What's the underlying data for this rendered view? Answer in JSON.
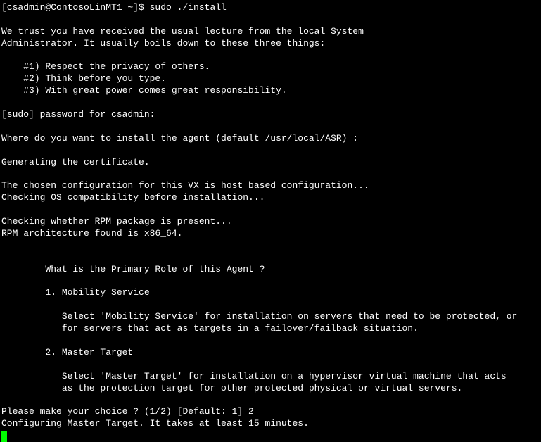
{
  "terminal": {
    "prompt_line": "[csadmin@ContosoLinMT1 ~]$ sudo ./install",
    "blank": "",
    "lecture_1": "We trust you have received the usual lecture from the local System",
    "lecture_2": "Administrator. It usually boils down to these three things:",
    "rule_1": "    #1) Respect the privacy of others.",
    "rule_2": "    #2) Think before you type.",
    "rule_3": "    #3) With great power comes great responsibility.",
    "password_prompt": "[sudo] password for csadmin:",
    "install_location": "Where do you want to install the agent (default /usr/local/ASR) :",
    "gen_cert": "Generating the certificate.",
    "config_line": "The chosen configuration for this VX is host based configuration...",
    "os_check": "Checking OS compatibility before installation...",
    "rpm_check": "Checking whether RPM package is present...",
    "rpm_arch": "RPM architecture found is x86_64.",
    "role_question": "        What is the Primary Role of this Agent ?",
    "option_1": "        1. Mobility Service",
    "option_1_desc_a": "           Select 'Mobility Service' for installation on servers that need to be protected, or",
    "option_1_desc_b": "           for servers that act as targets in a failover/failback situation.",
    "option_2": "        2. Master Target",
    "option_2_desc_a": "           Select 'Master Target' for installation on a hypervisor virtual machine that acts",
    "option_2_desc_b": "           as the protection target for other protected physical or virtual servers.",
    "choice_prompt": "Please make your choice ? (1/2) [Default: 1] 2",
    "configuring": "Configuring Master Target. It takes at least 15 minutes."
  }
}
